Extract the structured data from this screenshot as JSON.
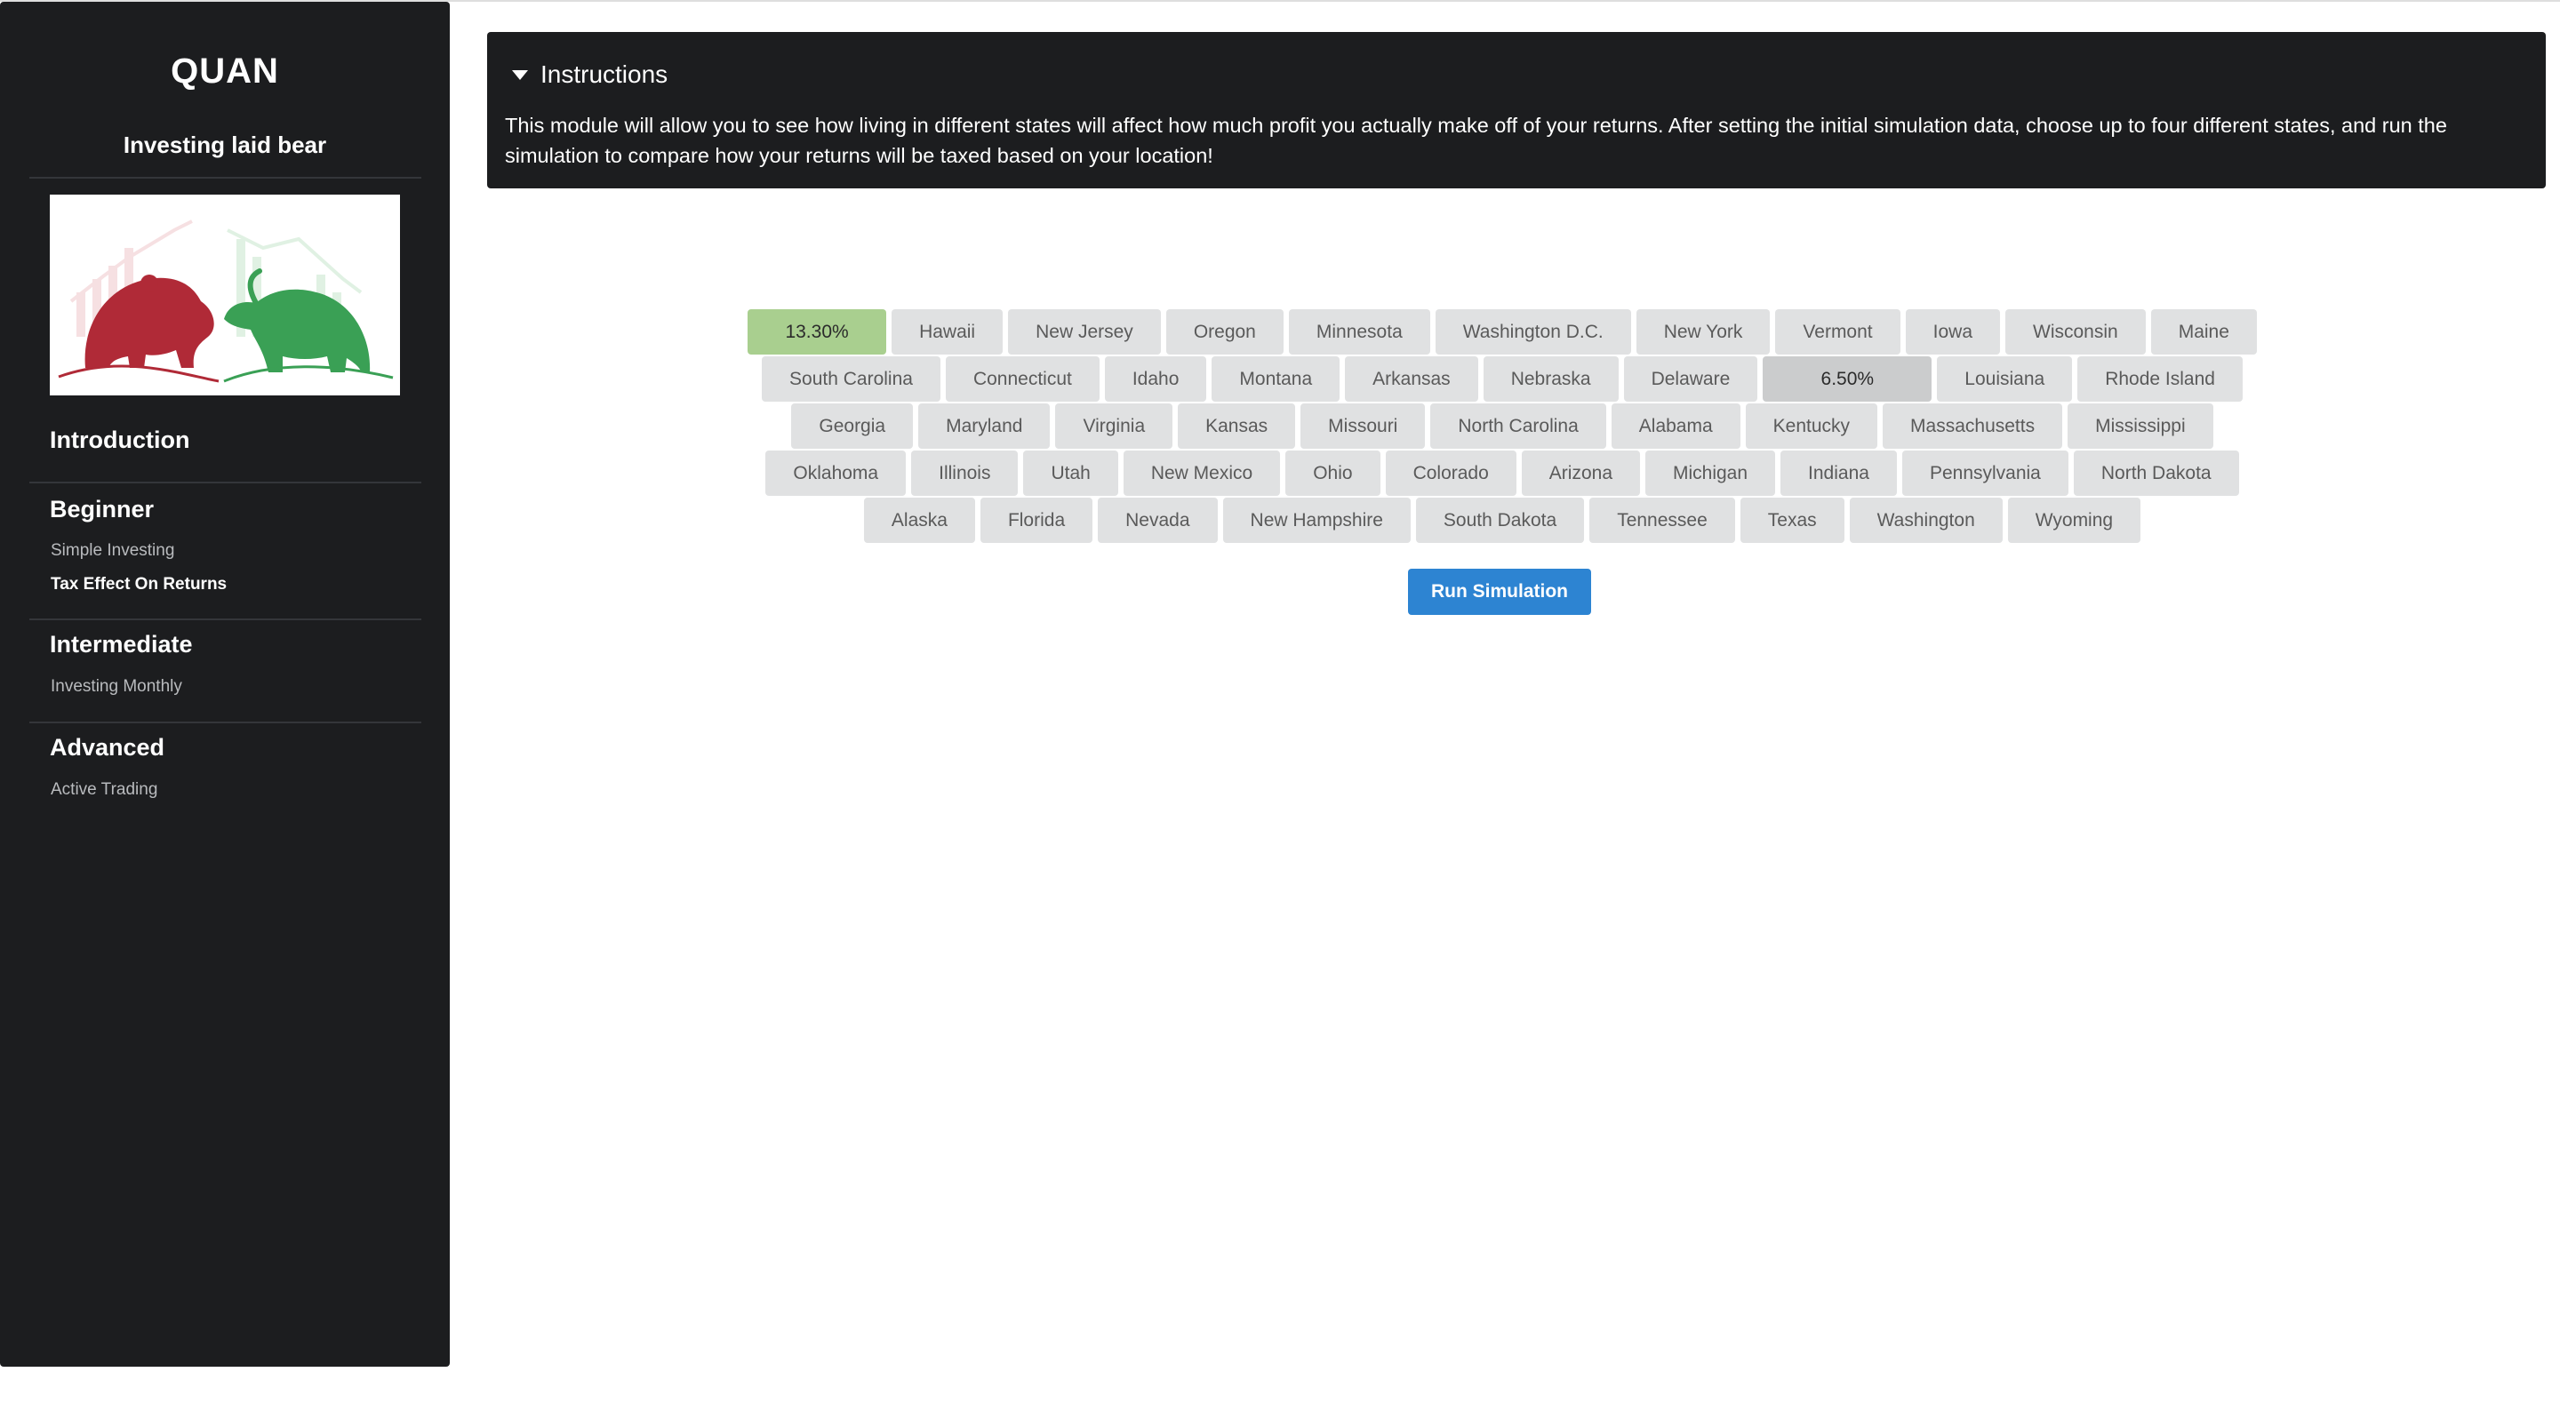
{
  "sidebar": {
    "brand": "QUAN",
    "tagline": "Investing laid bear",
    "sections": [
      {
        "heading": "Introduction",
        "items": []
      },
      {
        "heading": "Beginner",
        "items": [
          "Simple Investing",
          "Tax Effect On Returns"
        ]
      },
      {
        "heading": "Intermediate",
        "items": [
          "Investing Monthly"
        ]
      },
      {
        "heading": "Advanced",
        "items": [
          "Active Trading"
        ]
      }
    ],
    "active_item": "Tax Effect On Returns"
  },
  "instructions": {
    "title": "Instructions",
    "body": "This module will allow you to see how living in different states will affect how much profit you actually make off of your returns. After setting the initial simulation data, choose up to four different states, and run the simulation to compare how your returns will be taxed based on your location!"
  },
  "states": {
    "rows": [
      [
        "13.30%",
        "Hawaii",
        "New Jersey",
        "Oregon",
        "Minnesota",
        "Washington D.C.",
        "New York",
        "Vermont",
        "Iowa",
        "Wisconsin",
        "Maine"
      ],
      [
        "South Carolina",
        "Connecticut",
        "Idaho",
        "Montana",
        "Arkansas",
        "Nebraska",
        "Delaware",
        "6.50%",
        "Louisiana",
        "Rhode Island"
      ],
      [
        "Georgia",
        "Maryland",
        "Virginia",
        "Kansas",
        "Missouri",
        "North Carolina",
        "Alabama",
        "Kentucky",
        "Massachusetts",
        "Mississippi"
      ],
      [
        "Oklahoma",
        "Illinois",
        "Utah",
        "New Mexico",
        "Ohio",
        "Colorado",
        "Arizona",
        "Michigan",
        "Indiana",
        "Pennsylvania",
        "North Dakota"
      ],
      [
        "Alaska",
        "Florida",
        "Nevada",
        "New Hampshire",
        "South Dakota",
        "Tennessee",
        "Texas",
        "Washington",
        "Wyoming"
      ]
    ],
    "selected_green": "13.30%",
    "selected_gray": "6.50%",
    "colors": {
      "chip": "#e0e1e2",
      "green": "#a9cf8f",
      "gray": "#cbcccd"
    }
  },
  "run_button": "Run Simulation",
  "colors": {
    "panel": "#1c1d1f",
    "primary": "#2d84d2"
  }
}
